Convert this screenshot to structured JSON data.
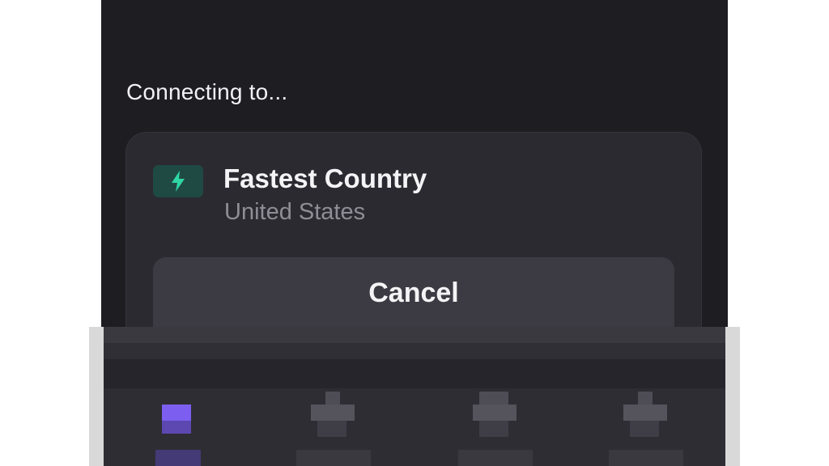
{
  "connection": {
    "status_text": "Connecting to..."
  },
  "server_card": {
    "icon": "lightning-bolt-icon",
    "title": "Fastest Country",
    "subtitle": "United States",
    "cancel_label": "Cancel"
  },
  "tab_bar": {
    "tabs": [
      {
        "icon": "pixelated-tab-icon",
        "active": true
      },
      {
        "icon": "pixelated-tab-icon",
        "active": false
      },
      {
        "icon": "pixelated-tab-icon",
        "active": false
      },
      {
        "icon": "pixelated-tab-icon",
        "active": false
      }
    ]
  },
  "colors": {
    "background": "#1e1d22",
    "card": "#2b2a31",
    "accent": "#2fd6a3",
    "active_tab": "#7c5ff0",
    "button": "#3c3b43"
  }
}
